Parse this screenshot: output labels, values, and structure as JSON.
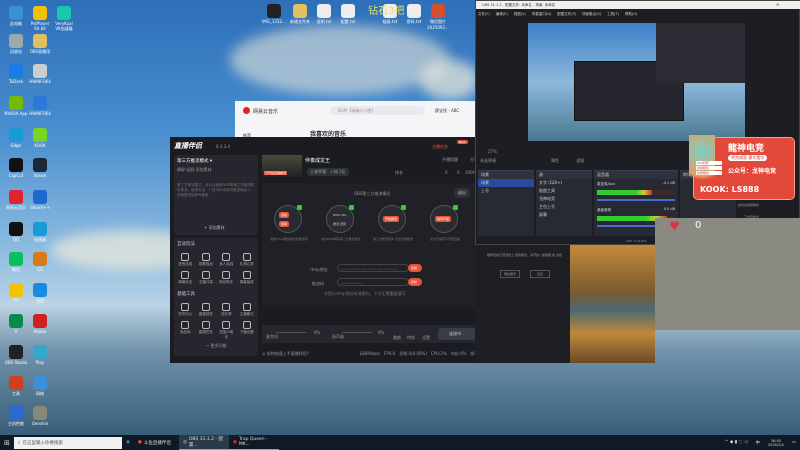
{
  "desktop": {
    "watermark": "钻石3把",
    "left_icons": [
      {
        "label": "此电脑",
        "color": "#3a8fd8"
      },
      {
        "label": "PotPlayer 64 bit",
        "color": "#f2c200"
      },
      {
        "label": "VeryKuai VK加速器",
        "color": "#1cc7b1"
      },
      {
        "label": "回收站",
        "color": "#9aa"
      },
      {
        "label": "OBS直播用",
        "color": "#e0c060"
      },
      {
        "label": "ToDesk",
        "color": "#1a7ae6"
      },
      {
        "label": "HWiNFO64",
        "color": "#ccc"
      },
      {
        "label": "NVIDIA App",
        "color": "#76b900"
      },
      {
        "label": "HWiNFO64",
        "color": "#2a7ad8"
      },
      {
        "label": "Edge",
        "color": "#1a9ad8"
      },
      {
        "label": "KOOK",
        "color": "#7ad321"
      },
      {
        "label": "CapCut",
        "color": "#111"
      },
      {
        "label": "Steam",
        "color": "#1b2838"
      },
      {
        "label": "网易云音乐",
        "color": "#e0222a"
      },
      {
        "label": "Steam++",
        "color": "#1a6ad0"
      },
      {
        "label": "QQ",
        "color": "#111"
      },
      {
        "label": "加速器",
        "color": "#1a9ad8"
      },
      {
        "label": "微信",
        "color": "#07c160"
      },
      {
        "label": "CS",
        "color": "#d87a1a"
      },
      {
        "label": "YY",
        "color": "#f2c200"
      },
      {
        "label": "迅游",
        "color": "#1a8ae0"
      },
      {
        "label": "A",
        "color": "#0a8a4a"
      },
      {
        "label": "Adobe",
        "color": "#d02020"
      },
      {
        "label": "OBS Studio",
        "color": "#222"
      },
      {
        "label": "Play",
        "color": "#3ac"
      },
      {
        "label": "工具",
        "color": "#d04020"
      },
      {
        "label": "网络",
        "color": "#3a8fd8"
      },
      {
        "label": "主机性能",
        "color": "#2a6ad0"
      },
      {
        "label": "Genshin",
        "color": "#887"
      }
    ],
    "top_icons": [
      {
        "label": "IMG_1312...",
        "color": "#222"
      },
      {
        "label": "新建文件夹",
        "color": "#e0c060"
      },
      {
        "label": "说明.txt",
        "color": "#eee"
      },
      {
        "label": "配置.txt",
        "color": "#eee"
      },
      {
        "label": "链接.txt",
        "color": "#eee"
      },
      {
        "label": "密码.txt",
        "color": "#eee"
      },
      {
        "label": "微信图片 2025092...",
        "color": "#d05030"
      }
    ]
  },
  "netease": {
    "title": "网易云音乐",
    "search_placeholder": "BGM【瑞幽の小曲】",
    "user": "薛宝钗 - ABC",
    "page_title": "我喜欢的音乐",
    "nav_item": "推荐"
  },
  "live_app": {
    "title": "直播伴侣",
    "version": "6.3.3.4",
    "live_button": "主播任务",
    "new_badge": "New",
    "sidebar": {
      "mode_label": "第三方推流模式 ▾",
      "mode_tabs": "横屏·竖屏·添加素材",
      "note": "第三方推流模式，此可以使用OBS等第三方推流软件推流，使用方法：1.在OBS中填写推流地址 2.开始推流后即可使用",
      "add_material": "+ 添加素材",
      "section_interact": "互动玩法",
      "interact": [
        "语音连线",
        "观看挑战",
        "多人连线",
        "礼物心愿",
        "弹幕玩法",
        "主播口袋",
        "粉丝助手",
        "弹幕抽奖"
      ],
      "section_tools": "基础工具",
      "tools": [
        "任务中心",
        "直播回放",
        "送礼榜",
        "主播备忘",
        "商品库",
        "星图任务",
        "连接小助手",
        "下播设置"
      ],
      "more": "— 更多功能"
    },
    "stream": {
      "name": "伴奏成龙王",
      "category": "王者荣耀 · 人物 2区",
      "thumb_text": "已开启直播推流",
      "viewers": "开播提醒",
      "share": "分享",
      "rank": "排名",
      "likes": "0",
      "heat": "0",
      "percent": "100%"
    },
    "obs_mode": {
      "title": "OBS第三方推流模式",
      "exit": "退出",
      "steps": [
        {
          "label": "复制rtmp推流地址和推流码",
          "btns": [
            "复制",
            "复制"
          ]
        },
        {
          "label": "在OBS中填写第三方推流信息",
          "btns": [
            "RMS URL",
            "推流 密钥"
          ]
        },
        {
          "label": "第三方推流软件 点击开始推流",
          "btns": [
            "开始推流"
          ]
        },
        {
          "label": "点击开播即可开始直播",
          "btns": [
            "等待开播"
          ]
        }
      ],
      "rtmp_label": "rtmp地址",
      "rtmp_value": "••••••••••••••••••••••••••••••••",
      "key_label": "推流码",
      "key_value": "••••••••••••",
      "copy": "复制",
      "hint": "本提示rtmp地址有效期内，下次无需重复填写"
    },
    "bottom": {
      "mic": "麦克风",
      "mic_pct": "0%",
      "sound": "扬声器",
      "sound_pct": "0%",
      "beauty": "美颜",
      "effects": "特效",
      "settings": "设置",
      "go_live": "连接中...",
      "footer_left": "◎ 如何快速上手直播伴侣?",
      "footer_stats": [
        "码率0kbps",
        "FPS:0",
        "丢帧:0(0.00%)",
        "CPU:2%",
        "内存:0%",
        "帧率:0"
      ]
    }
  },
  "obs": {
    "title": "OBS 31.1.2 - 配置文件: 未命名 - 场景: 未命名",
    "menu": [
      "文件(F)",
      "编辑(E)",
      "视图(V)",
      "停靠窗口(D)",
      "配置文件(P)",
      "场景集合(S)",
      "工具(T)",
      "帮助(H)"
    ],
    "zoom": "27%",
    "no_source": "未选择源",
    "props": "属性",
    "filters": "滤镜",
    "docks": {
      "scenes": "场景",
      "sources": "源",
      "mixer": "混音器",
      "transitions": "转场特效"
    },
    "scenes": [
      "场景",
      "上号"
    ],
    "sources": [
      "文字 (GDI+)",
      "贴图工具",
      "龙神电竞",
      "主包上号",
      "屏幕"
    ],
    "mixer": [
      {
        "name": "麦克风/Aux",
        "db": "-4.1 dB",
        "level": 0.7
      },
      {
        "name": "桌面音频",
        "db": "0.0 dB",
        "level": 0.9
      }
    ],
    "status": "CPU: 0 (0.0%)",
    "start_virtual_cam": "启动虚拟摄像机",
    "studio_mode": "工作室模式",
    "dock_msg": "推荐自动已经登陆上 使用网页，请开启 / 播放器 或 设置",
    "dock_btn1": "网站服务",
    "dock_btn2": "设置"
  },
  "ad": {
    "title": "龍神电竞",
    "sub": "鸡完成契 惠式相尔",
    "line1": "公众号：龙神电竞",
    "line2": "KOOK: LS888",
    "badges": [
      "3X3代肝",
      "护航陪玩",
      "优质陪玩"
    ]
  },
  "heart_widget": {
    "count": "0",
    "color": "#e0304a"
  },
  "taskbar": {
    "search_placeholder": "在这里输入你要搜索",
    "apps": [
      "斗鱼直播伴侣",
      "OBS 31.1.2 - 配置...",
      "Trap Queen - MK..."
    ],
    "time": "18:40",
    "date": "2025/2/4",
    "lang": "中"
  }
}
